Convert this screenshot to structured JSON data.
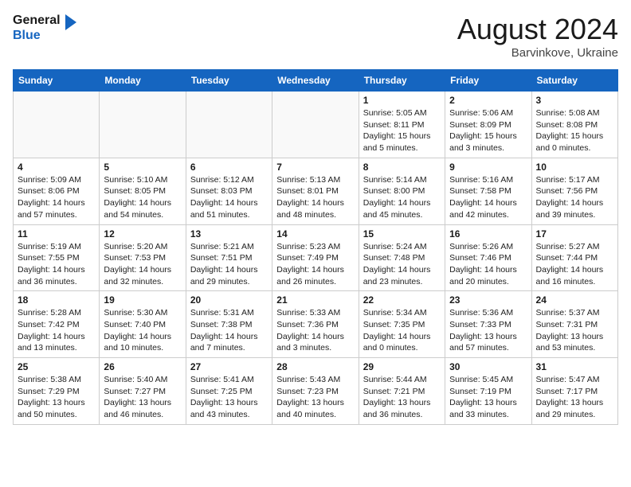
{
  "header": {
    "logo_general": "General",
    "logo_blue": "Blue",
    "month_title": "August 2024",
    "location": "Barvinkove, Ukraine"
  },
  "weekdays": [
    "Sunday",
    "Monday",
    "Tuesday",
    "Wednesday",
    "Thursday",
    "Friday",
    "Saturday"
  ],
  "weeks": [
    [
      {
        "day": "",
        "info": ""
      },
      {
        "day": "",
        "info": ""
      },
      {
        "day": "",
        "info": ""
      },
      {
        "day": "",
        "info": ""
      },
      {
        "day": "1",
        "info": "Sunrise: 5:05 AM\nSunset: 8:11 PM\nDaylight: 15 hours\nand 5 minutes."
      },
      {
        "day": "2",
        "info": "Sunrise: 5:06 AM\nSunset: 8:09 PM\nDaylight: 15 hours\nand 3 minutes."
      },
      {
        "day": "3",
        "info": "Sunrise: 5:08 AM\nSunset: 8:08 PM\nDaylight: 15 hours\nand 0 minutes."
      }
    ],
    [
      {
        "day": "4",
        "info": "Sunrise: 5:09 AM\nSunset: 8:06 PM\nDaylight: 14 hours\nand 57 minutes."
      },
      {
        "day": "5",
        "info": "Sunrise: 5:10 AM\nSunset: 8:05 PM\nDaylight: 14 hours\nand 54 minutes."
      },
      {
        "day": "6",
        "info": "Sunrise: 5:12 AM\nSunset: 8:03 PM\nDaylight: 14 hours\nand 51 minutes."
      },
      {
        "day": "7",
        "info": "Sunrise: 5:13 AM\nSunset: 8:01 PM\nDaylight: 14 hours\nand 48 minutes."
      },
      {
        "day": "8",
        "info": "Sunrise: 5:14 AM\nSunset: 8:00 PM\nDaylight: 14 hours\nand 45 minutes."
      },
      {
        "day": "9",
        "info": "Sunrise: 5:16 AM\nSunset: 7:58 PM\nDaylight: 14 hours\nand 42 minutes."
      },
      {
        "day": "10",
        "info": "Sunrise: 5:17 AM\nSunset: 7:56 PM\nDaylight: 14 hours\nand 39 minutes."
      }
    ],
    [
      {
        "day": "11",
        "info": "Sunrise: 5:19 AM\nSunset: 7:55 PM\nDaylight: 14 hours\nand 36 minutes."
      },
      {
        "day": "12",
        "info": "Sunrise: 5:20 AM\nSunset: 7:53 PM\nDaylight: 14 hours\nand 32 minutes."
      },
      {
        "day": "13",
        "info": "Sunrise: 5:21 AM\nSunset: 7:51 PM\nDaylight: 14 hours\nand 29 minutes."
      },
      {
        "day": "14",
        "info": "Sunrise: 5:23 AM\nSunset: 7:49 PM\nDaylight: 14 hours\nand 26 minutes."
      },
      {
        "day": "15",
        "info": "Sunrise: 5:24 AM\nSunset: 7:48 PM\nDaylight: 14 hours\nand 23 minutes."
      },
      {
        "day": "16",
        "info": "Sunrise: 5:26 AM\nSunset: 7:46 PM\nDaylight: 14 hours\nand 20 minutes."
      },
      {
        "day": "17",
        "info": "Sunrise: 5:27 AM\nSunset: 7:44 PM\nDaylight: 14 hours\nand 16 minutes."
      }
    ],
    [
      {
        "day": "18",
        "info": "Sunrise: 5:28 AM\nSunset: 7:42 PM\nDaylight: 14 hours\nand 13 minutes."
      },
      {
        "day": "19",
        "info": "Sunrise: 5:30 AM\nSunset: 7:40 PM\nDaylight: 14 hours\nand 10 minutes."
      },
      {
        "day": "20",
        "info": "Sunrise: 5:31 AM\nSunset: 7:38 PM\nDaylight: 14 hours\nand 7 minutes."
      },
      {
        "day": "21",
        "info": "Sunrise: 5:33 AM\nSunset: 7:36 PM\nDaylight: 14 hours\nand 3 minutes."
      },
      {
        "day": "22",
        "info": "Sunrise: 5:34 AM\nSunset: 7:35 PM\nDaylight: 14 hours\nand 0 minutes."
      },
      {
        "day": "23",
        "info": "Sunrise: 5:36 AM\nSunset: 7:33 PM\nDaylight: 13 hours\nand 57 minutes."
      },
      {
        "day": "24",
        "info": "Sunrise: 5:37 AM\nSunset: 7:31 PM\nDaylight: 13 hours\nand 53 minutes."
      }
    ],
    [
      {
        "day": "25",
        "info": "Sunrise: 5:38 AM\nSunset: 7:29 PM\nDaylight: 13 hours\nand 50 minutes."
      },
      {
        "day": "26",
        "info": "Sunrise: 5:40 AM\nSunset: 7:27 PM\nDaylight: 13 hours\nand 46 minutes."
      },
      {
        "day": "27",
        "info": "Sunrise: 5:41 AM\nSunset: 7:25 PM\nDaylight: 13 hours\nand 43 minutes."
      },
      {
        "day": "28",
        "info": "Sunrise: 5:43 AM\nSunset: 7:23 PM\nDaylight: 13 hours\nand 40 minutes."
      },
      {
        "day": "29",
        "info": "Sunrise: 5:44 AM\nSunset: 7:21 PM\nDaylight: 13 hours\nand 36 minutes."
      },
      {
        "day": "30",
        "info": "Sunrise: 5:45 AM\nSunset: 7:19 PM\nDaylight: 13 hours\nand 33 minutes."
      },
      {
        "day": "31",
        "info": "Sunrise: 5:47 AM\nSunset: 7:17 PM\nDaylight: 13 hours\nand 29 minutes."
      }
    ]
  ]
}
